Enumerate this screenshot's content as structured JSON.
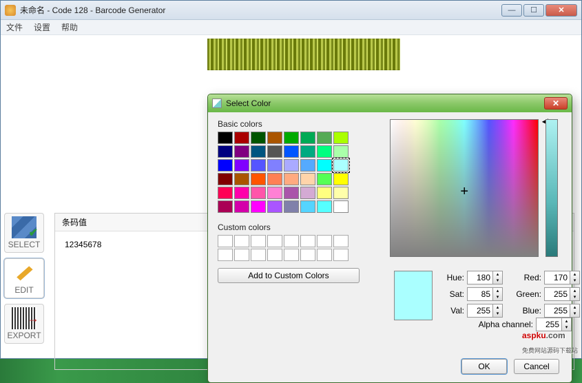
{
  "window": {
    "title": "未命名 - Code 128 - Barcode Generator"
  },
  "menu": {
    "file": "文件",
    "settings": "设置",
    "help": "帮助"
  },
  "side": {
    "select": "SELECT",
    "edit": "EDIT",
    "export": "EXPORT"
  },
  "barcode_value": {
    "header": "条码值",
    "value": "12345678"
  },
  "dialog": {
    "title": "Select Color",
    "basic_colors_label": "Basic colors",
    "custom_colors_label": "Custom colors",
    "add_button": "Add to Custom Colors",
    "ok": "OK",
    "cancel": "Cancel",
    "fields": {
      "hue_label": "Hue:",
      "hue": "180",
      "sat_label": "Sat:",
      "sat": "85",
      "val_label": "Val:",
      "val": "255",
      "red_label": "Red:",
      "red": "170",
      "green_label": "Green:",
      "green": "255",
      "blue_label": "Blue:",
      "blue": "255",
      "alpha_label": "Alpha channel:",
      "alpha": "255"
    },
    "selected_color": "#AAFFFF",
    "basic_colors": [
      "#000000",
      "#aa0000",
      "#005500",
      "#aa5500",
      "#00aa00",
      "#00aa55",
      "#55aa55",
      "#aaff00",
      "#000080",
      "#800080",
      "#005580",
      "#555555",
      "#0055ff",
      "#00aa80",
      "#00ff80",
      "#aaffaa",
      "#0000ff",
      "#8000ff",
      "#5555ff",
      "#8080ff",
      "#aaaaff",
      "#55aaff",
      "#00ffff",
      "#aaffff",
      "#800000",
      "#aa5500",
      "#ff5500",
      "#ff8055",
      "#ffaa80",
      "#ffd4aa",
      "#55ff55",
      "#ffff00",
      "#ff0055",
      "#ff00aa",
      "#ff55aa",
      "#ff80d4",
      "#aa55aa",
      "#d4aad4",
      "#ffff80",
      "#ffffaa",
      "#aa0055",
      "#d400aa",
      "#ff00ff",
      "#aa55ff",
      "#8080aa",
      "#55d4ff",
      "#55ffff",
      "#ffffff"
    ]
  },
  "watermark": {
    "brand": "aspku",
    "tld": ".com",
    "tagline": "免费网站源码下载站"
  }
}
